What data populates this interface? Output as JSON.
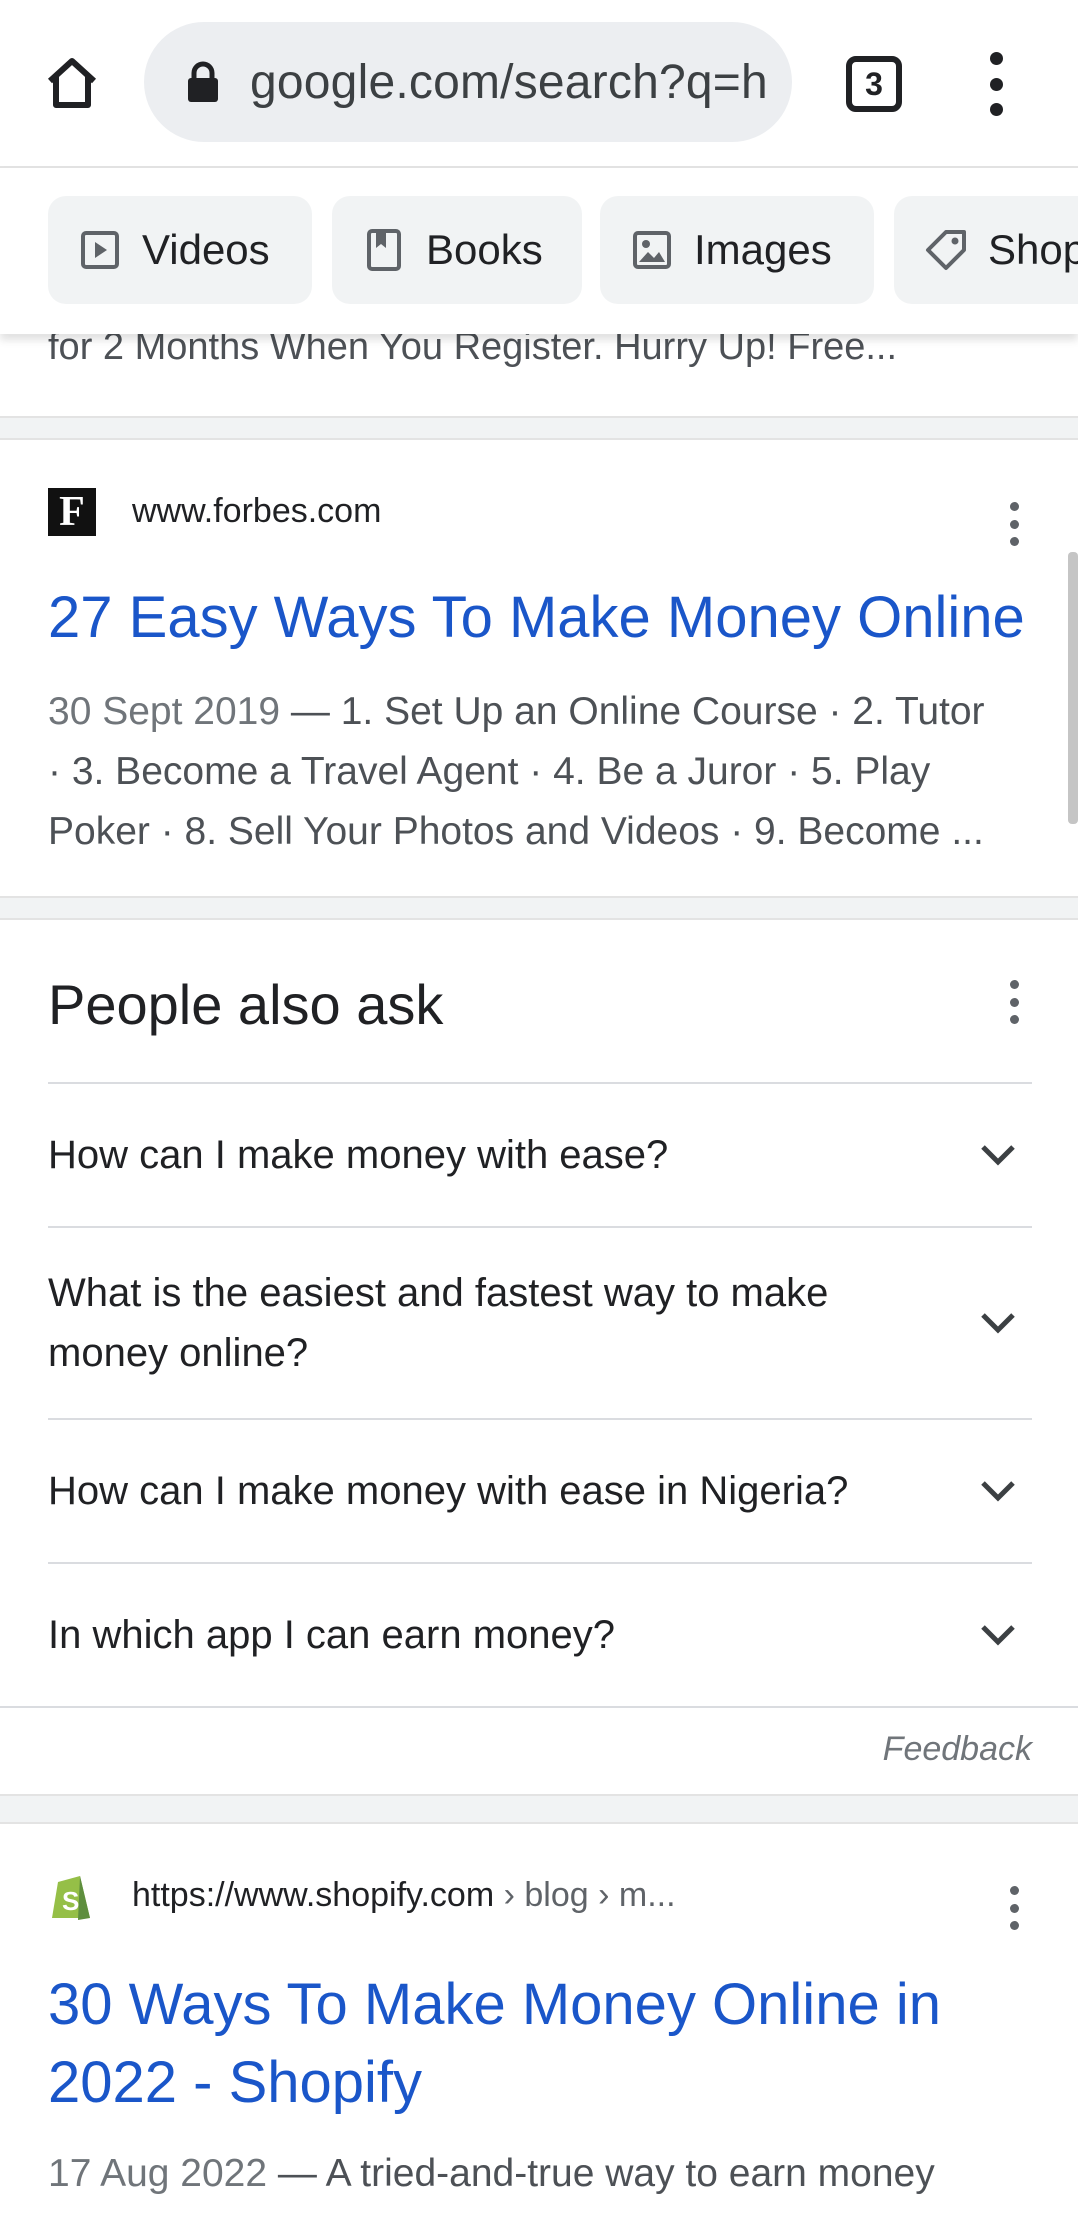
{
  "browser": {
    "url": "google.com/search?q=h",
    "tab_count": "3",
    "icons": {
      "home": "home-icon",
      "lock": "lock-icon",
      "menu": "more-vert-icon"
    }
  },
  "chips": [
    {
      "label": "Videos",
      "icon": "play-icon"
    },
    {
      "label": "Books",
      "icon": "book-icon"
    },
    {
      "label": "Images",
      "icon": "image-icon"
    },
    {
      "label": "Shop",
      "icon": "tag-icon"
    }
  ],
  "previous_snippet_tail": "for 2 Months When You Register. Hurry Up! Free...",
  "result_forbes": {
    "site": "www.forbes.com",
    "favicon_letter": "F",
    "title": "27 Easy Ways To Make Money Online",
    "date": "30 Sept 2019",
    "snippet_line1": " — 1. Set Up an Online Course · 2. Tutor",
    "snippet_line2": "· 3. Become a Travel Agent · 4. Be a Juror · 5. Play",
    "snippet_line3": "Poker · 8. Sell Your Photos and Videos · 9. Become ..."
  },
  "people_also_ask": {
    "heading": "People also ask",
    "questions": [
      "How can I make money with ease?",
      "What is the easiest and fastest way to make money online?",
      "How can I make money with ease in Nigeria?",
      "In which app I can earn money?"
    ],
    "feedback_label": "Feedback"
  },
  "result_shopify": {
    "site": "https://www.shopify.com",
    "breadcrumb": " › blog › m...",
    "title_line1": "30 Ways To Make Money Online in",
    "title_line2": "2022 - Shopify",
    "date": "17 Aug 2022",
    "snippet": " — A tried-and-true way to earn money"
  }
}
